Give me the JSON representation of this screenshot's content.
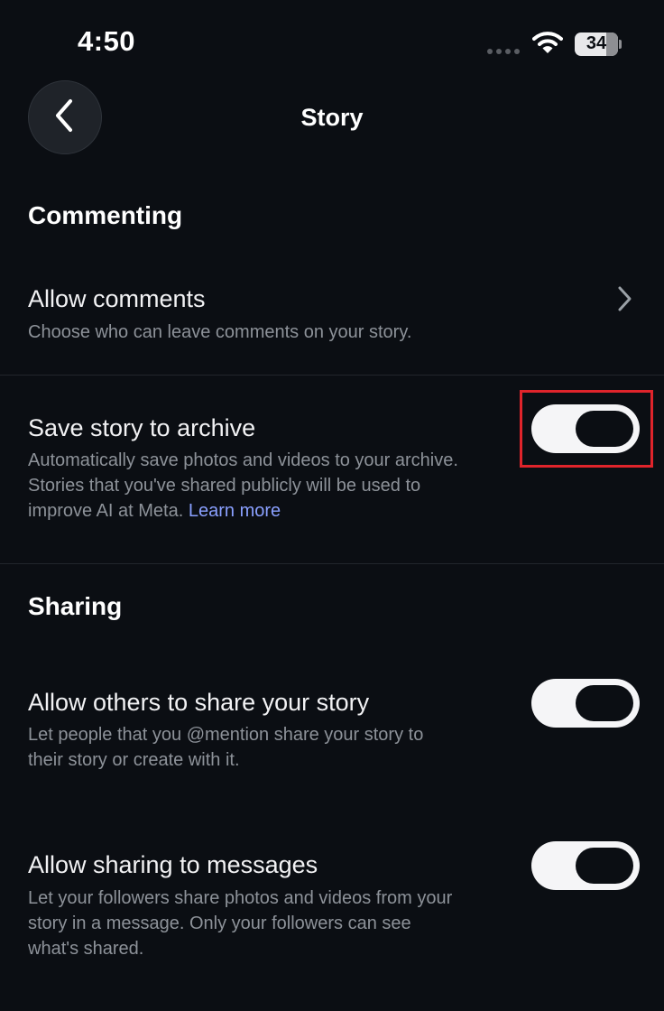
{
  "status_bar": {
    "time": "4:50",
    "battery": "34",
    "icons": [
      "cellular-signal-icon",
      "wifi-icon",
      "battery-icon"
    ]
  },
  "header": {
    "title": "Story",
    "back_icon": "chevron-left-icon"
  },
  "sections": {
    "commenting": {
      "heading": "Commenting",
      "allow_comments": {
        "title": "Allow comments",
        "description": "Choose who can leave comments on your story.",
        "icon": "chevron-right-icon"
      },
      "save_archive": {
        "title": "Save story to archive",
        "description_line1": "Automatically save photos and videos to your archive.",
        "description_line2": "Stories that you've shared publicly will be used to",
        "description_line3": "improve AI at Meta.",
        "link": "Learn more",
        "toggle_on": true
      }
    },
    "sharing": {
      "heading": "Sharing",
      "share_story": {
        "title": "Allow others to share your story",
        "description_line1": "Let people that you @mention share your story to",
        "description_line2": "their story or create with it.",
        "toggle_on": true
      },
      "share_messages": {
        "title": "Allow sharing to messages",
        "description_line1": "Let your followers share photos and videos from your",
        "description_line2": "story in a message. Only your followers can see",
        "description_line3": "what's shared.",
        "toggle_on": true
      }
    }
  },
  "colors": {
    "background": "#0b0e13",
    "link": "#8aa0ff",
    "highlight": "#e0242b"
  }
}
